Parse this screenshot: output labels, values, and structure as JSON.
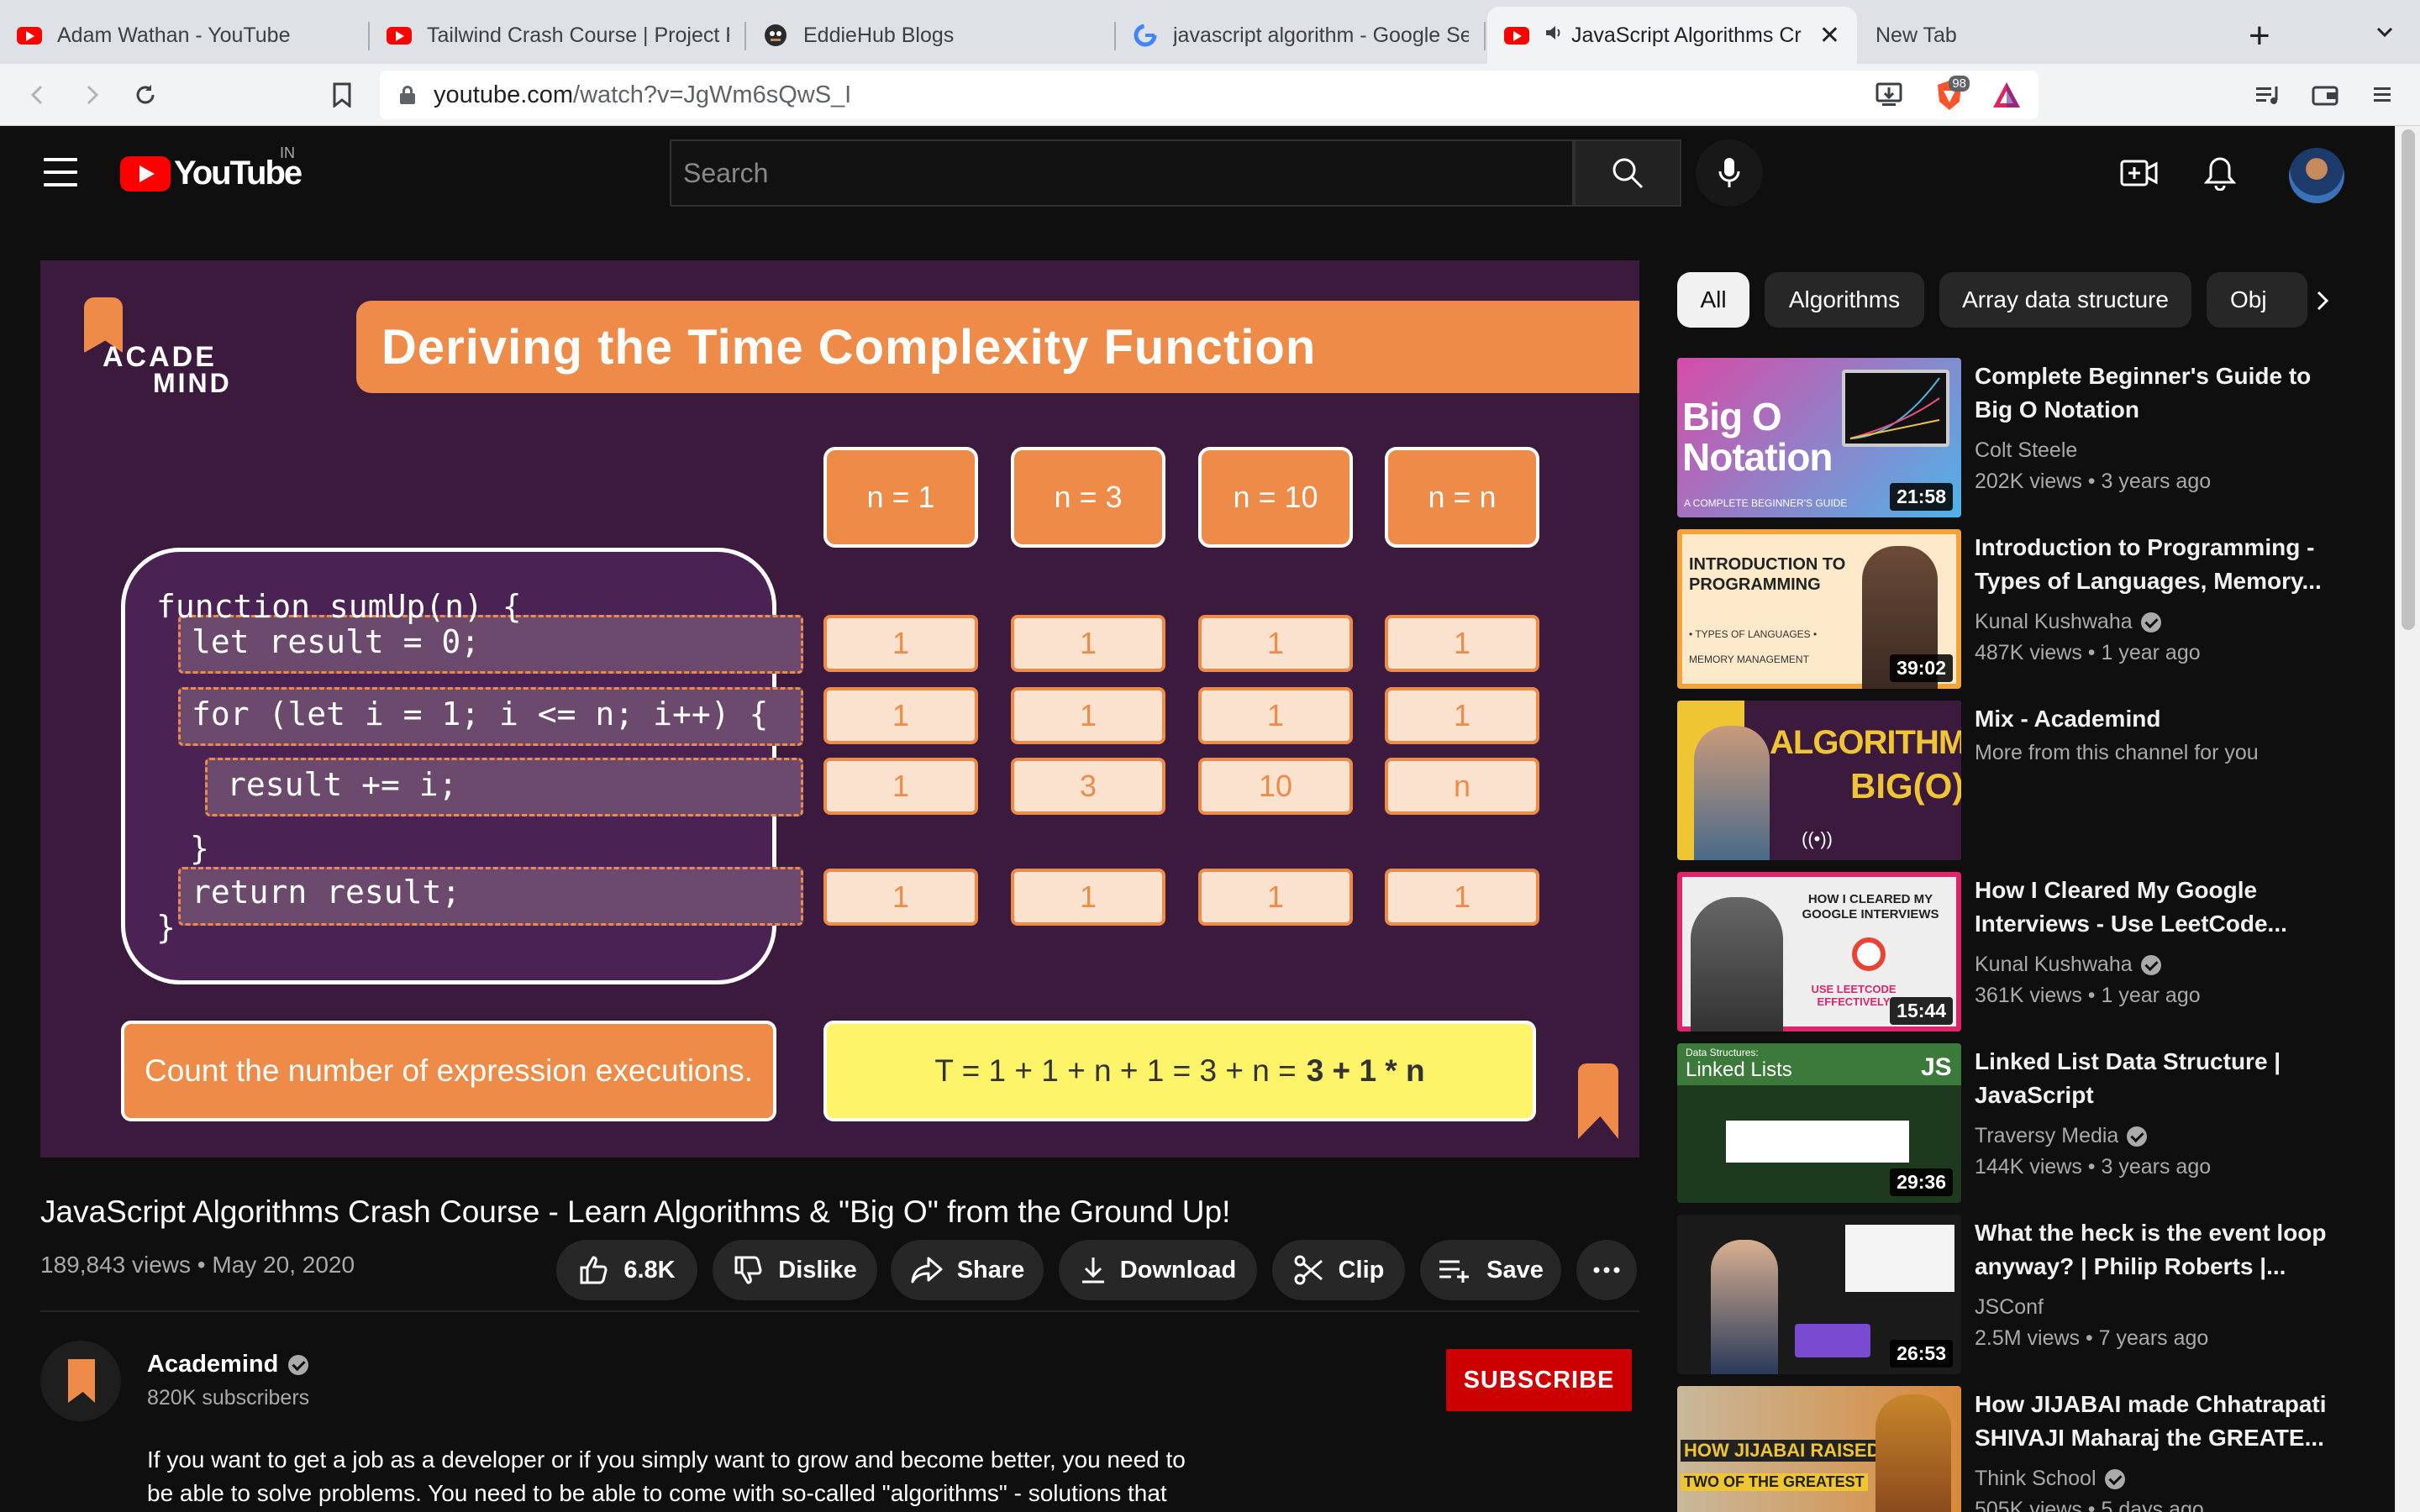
{
  "browser": {
    "tabs": [
      {
        "title": "Adam Wathan - YouTube",
        "icon": "youtube-favicon"
      },
      {
        "title": "Tailwind Crash Course | Project F",
        "icon": "youtube-favicon"
      },
      {
        "title": "EddieHub Blogs",
        "icon": "eddiehub-favicon"
      },
      {
        "title": "javascript algorithm - Google Se",
        "icon": "google-favicon"
      },
      {
        "title": "JavaScript Algorithms Cr",
        "icon": "youtube-favicon",
        "active": true
      },
      {
        "title": "New Tab",
        "icon": ""
      }
    ],
    "new_tab_symbol": "+",
    "tab_menu_symbol": "⌄",
    "url_domain": "youtube.com",
    "url_path": "/watch?v=JgWm6sQwS_I",
    "brave_badge": "98"
  },
  "youtube": {
    "country_code": "IN",
    "logo_text": "YouTube",
    "search_placeholder": "Search"
  },
  "slide": {
    "title": "Deriving the Time Complexity Function",
    "logo_line1": "ACADE",
    "logo_line2": "MIND",
    "columns": [
      "n = 1",
      "n = 3",
      "n = 10",
      "n = n"
    ],
    "code": {
      "line1": "function sumUp(n) {",
      "line2": "let result = 0;",
      "line3": "for (let i = 1; i <= n; i++) {",
      "line4": "result += i;",
      "line5": "}",
      "line6": "return result;",
      "line7": "}"
    },
    "rows": [
      [
        "1",
        "1",
        "1",
        "1"
      ],
      [
        "1",
        "1",
        "1",
        "1"
      ],
      [
        "1",
        "3",
        "10",
        "n"
      ],
      [
        "1",
        "1",
        "1",
        "1"
      ]
    ],
    "count_text": "Count the number of expression executions.",
    "formula_text": "T = 1 + 1 + n + 1 = 3 + n =",
    "formula_bold": "3 + 1 * n"
  },
  "video": {
    "title": "JavaScript Algorithms Crash Course - Learn Algorithms & \"Big O\" from the Ground Up!",
    "meta": "189,843 views • May 20, 2020",
    "actions": {
      "likes": "6.8K",
      "dislike": "Dislike",
      "share": "Share",
      "download": "Download",
      "clip": "Clip",
      "save": "Save"
    },
    "channel": {
      "name": "Academind",
      "subscribers": "820K subscribers",
      "subscribe_label": "SUBSCRIBE"
    },
    "description": "If you want to get a job as a developer or if you simply want to grow and become better, you need to be able to solve problems. You need to be able to come with so-called \"algorithms\" - solutions that"
  },
  "sidebar": {
    "chips": [
      "All",
      "Algorithms",
      "Array data structure",
      "Obj"
    ],
    "recommendations": [
      {
        "title": "Complete Beginner's Guide to Big O Notation",
        "channel": "Colt Steele",
        "verified": false,
        "stats": "202K views • 3 years ago",
        "duration": "21:58",
        "thumb_text": "Big O Notation",
        "thumb_sub": "A COMPLETE BEGINNER'S GUIDE"
      },
      {
        "title": "Introduction to Programming - Types of Languages, Memory...",
        "channel": "Kunal Kushwaha",
        "verified": true,
        "stats": "487K views • 1 year ago",
        "duration": "39:02",
        "thumb_text": "INTRODUCTION TO PROGRAMMING",
        "thumb_sub": "• TYPES OF LANGUAGES  • MEMORY MANAGEMENT"
      },
      {
        "title": "Mix - Academind",
        "subtitle": "More from this channel for you",
        "duration": "",
        "thumb_text": "ALGORITHMS",
        "thumb_sub": "BIG(O)"
      },
      {
        "title": "How I Cleared My Google Interviews - Use LeetCode...",
        "channel": "Kunal Kushwaha",
        "verified": true,
        "stats": "361K views • 1 year ago",
        "duration": "15:44",
        "thumb_text": "HOW I CLEARED MY GOOGLE INTERVIEWS",
        "thumb_sub": "USE LEETCODE EFFECTIVELY"
      },
      {
        "title": "Linked List Data Structure | JavaScript",
        "channel": "Traversy Media",
        "verified": true,
        "stats": "144K views • 3 years ago",
        "duration": "29:36",
        "thumb_text": "Linked Lists",
        "thumb_sub": "Data Structures:"
      },
      {
        "title": "What the heck is the event loop anyway? | Philip Roberts |...",
        "channel": "JSConf",
        "verified": false,
        "stats": "2.5M views • 7 years ago",
        "duration": "26:53"
      },
      {
        "title": "How JIJABAI made Chhatrapati SHIVAJI Maharaj the GREATE...",
        "channel": "Think School",
        "verified": true,
        "stats": "505K views • 5 days ago",
        "duration": "",
        "thumb_text": "HOW JIJABAI RAISED",
        "thumb_sub": "TWO OF THE GREATEST"
      }
    ]
  },
  "colors": {
    "yt_bg": "#0f0f0f",
    "yt_red": "#ff0000",
    "subscribe_red": "#cc0000",
    "slide_bg": "#3b1a3e",
    "slide_orange": "#ee8b48",
    "formula_yellow": "#fdf46a"
  }
}
